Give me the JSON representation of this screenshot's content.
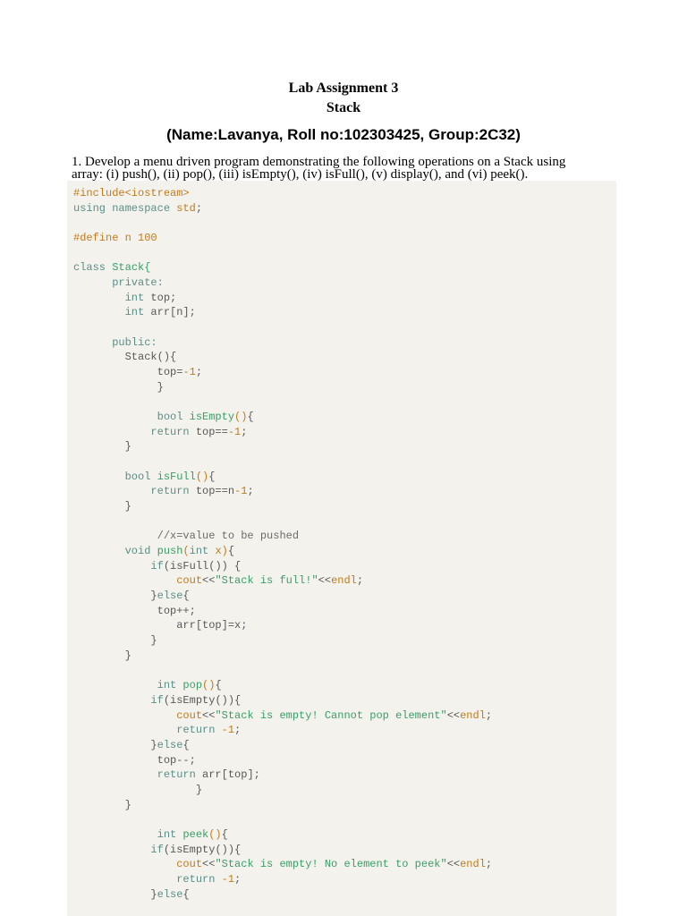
{
  "title": "Lab Assignment 3",
  "subtitle": "Stack",
  "student": "(Name:Lavanya, Roll no:102303425, Group:2C32)",
  "question_line1": "1. Develop a menu driven program demonstrating the following operations on a Stack using",
  "question_line2": "array: (i) push(),  (ii)  pop(),  (iii)  isEmpty(),  (iv)  isFull(),  (v)  display(), and  (vi) peek().",
  "code": [
    [
      [
        "o",
        "#include<iostream>"
      ]
    ],
    [
      [
        "k",
        "using namespace "
      ],
      [
        "o",
        "std"
      ],
      [
        "p",
        ";"
      ]
    ],
    [],
    [
      [
        "o",
        "#define n 100"
      ]
    ],
    [],
    [
      [
        "k",
        "class "
      ],
      [
        "g",
        "Stack{"
      ]
    ],
    [
      [
        "k",
        "      private:"
      ]
    ],
    [
      [
        "k",
        "        int "
      ],
      [
        "p",
        "top;"
      ]
    ],
    [
      [
        "k",
        "        int "
      ],
      [
        "p",
        "arr[n];"
      ]
    ],
    [],
    [
      [
        "k",
        "      public:"
      ]
    ],
    [
      [
        "p",
        "        Stack(){"
      ]
    ],
    [
      [
        "p",
        "             top="
      ],
      [
        "o",
        "-1"
      ],
      [
        "p",
        ";"
      ]
    ],
    [
      [
        "p",
        "             }"
      ]
    ],
    [],
    [
      [
        "k",
        "             bool "
      ],
      [
        "g",
        "isEmpty"
      ],
      [
        "o",
        "()"
      ],
      [
        "p",
        "{"
      ]
    ],
    [
      [
        "k",
        "            return "
      ],
      [
        "p",
        "top=="
      ],
      [
        "o",
        "-1"
      ],
      [
        "p",
        ";"
      ]
    ],
    [
      [
        "p",
        "        }"
      ]
    ],
    [],
    [
      [
        "k",
        "        bool "
      ],
      [
        "g",
        "isFull"
      ],
      [
        "o",
        "()"
      ],
      [
        "p",
        "{"
      ]
    ],
    [
      [
        "k",
        "            return "
      ],
      [
        "p",
        "top==n"
      ],
      [
        "o",
        "-1"
      ],
      [
        "p",
        ";"
      ]
    ],
    [
      [
        "p",
        "        }"
      ]
    ],
    [],
    [
      [
        "c",
        "             //x=value to be pushed"
      ]
    ],
    [
      [
        "k",
        "        void "
      ],
      [
        "g",
        "push"
      ],
      [
        "o",
        "("
      ],
      [
        "k",
        "int "
      ],
      [
        "o",
        "x)"
      ],
      [
        "p",
        "{"
      ]
    ],
    [
      [
        "k",
        "            if"
      ],
      [
        "p",
        "(isFull()) {"
      ]
    ],
    [
      [
        "o",
        "                cout"
      ],
      [
        "p",
        "<<"
      ],
      [
        "g",
        "\"Stack is full!\""
      ],
      [
        "p",
        "<<"
      ],
      [
        "o",
        "endl"
      ],
      [
        "p",
        ";"
      ]
    ],
    [
      [
        "p",
        "            }"
      ],
      [
        "k",
        "else"
      ],
      [
        "p",
        "{"
      ]
    ],
    [
      [
        "p",
        "             top++;"
      ]
    ],
    [
      [
        "p",
        "                arr[top]=x;"
      ]
    ],
    [
      [
        "p",
        "            }"
      ]
    ],
    [
      [
        "p",
        "        }"
      ]
    ],
    [],
    [
      [
        "k",
        "             int "
      ],
      [
        "g",
        "pop"
      ],
      [
        "o",
        "()"
      ],
      [
        "p",
        "{"
      ]
    ],
    [
      [
        "k",
        "            if"
      ],
      [
        "p",
        "(isEmpty()){"
      ]
    ],
    [
      [
        "o",
        "                cout"
      ],
      [
        "p",
        "<<"
      ],
      [
        "g",
        "\"Stack is empty! Cannot pop element\""
      ],
      [
        "p",
        "<<"
      ],
      [
        "o",
        "endl"
      ],
      [
        "p",
        ";"
      ]
    ],
    [
      [
        "k",
        "                return "
      ],
      [
        "o",
        "-1"
      ],
      [
        "p",
        ";"
      ]
    ],
    [
      [
        "p",
        "            }"
      ],
      [
        "k",
        "else"
      ],
      [
        "p",
        "{"
      ]
    ],
    [
      [
        "p",
        "             top--;"
      ]
    ],
    [
      [
        "k",
        "             return "
      ],
      [
        "p",
        "arr[top];"
      ]
    ],
    [
      [
        "p",
        "                   }"
      ]
    ],
    [
      [
        "p",
        "        }"
      ]
    ],
    [],
    [
      [
        "k",
        "             int "
      ],
      [
        "g",
        "peek"
      ],
      [
        "o",
        "()"
      ],
      [
        "p",
        "{"
      ]
    ],
    [
      [
        "k",
        "            if"
      ],
      [
        "p",
        "(isEmpty()){"
      ]
    ],
    [
      [
        "o",
        "                cout"
      ],
      [
        "p",
        "<<"
      ],
      [
        "g",
        "\"Stack is empty! No element to peek\""
      ],
      [
        "p",
        "<<"
      ],
      [
        "o",
        "endl"
      ],
      [
        "p",
        ";"
      ]
    ],
    [
      [
        "k",
        "                return "
      ],
      [
        "o",
        "-1"
      ],
      [
        "p",
        ";"
      ]
    ],
    [
      [
        "p",
        "            }"
      ],
      [
        "k",
        "else"
      ],
      [
        "p",
        "{"
      ]
    ]
  ]
}
